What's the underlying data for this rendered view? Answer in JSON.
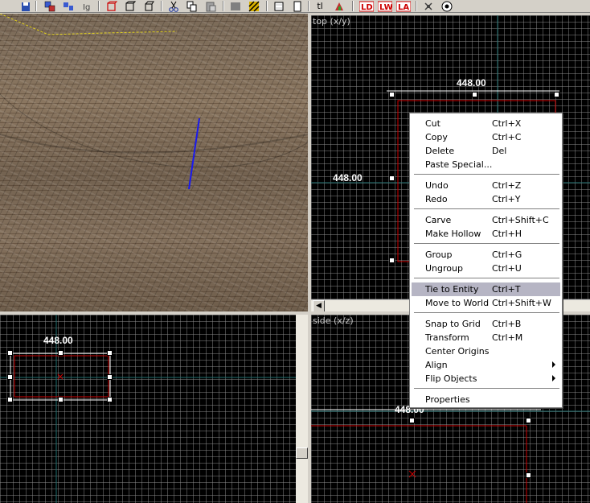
{
  "viewports": {
    "top": {
      "label": "top (x/y)",
      "width_label": "448.00",
      "height_label": "448.00"
    },
    "front": {
      "width_label": "448.00"
    },
    "side": {
      "label": "side (x/z)",
      "width_label": "448.00"
    }
  },
  "toolbar": {
    "icons": [
      "save-icon",
      "group-icon",
      "ungroup-icon",
      "ignore-groups-icon",
      "toggle-face-icon",
      "carve-icon",
      "hollow-icon",
      "cut-icon",
      "copy-icon",
      "paste-icon",
      "texture-lock-icon",
      "hide-items-icon",
      "snap-grid-icon",
      "toggle-grid-icon",
      "tl-icon",
      "entity-icon",
      "load-window-state-icon",
      "save-window-state-icon",
      "load-all-icon",
      "run-map-icon",
      "compile-icon"
    ],
    "tl_text": "tl",
    "colors": {
      "accent_red": "#cc0000",
      "accent_blue": "#0000cc"
    }
  },
  "context_menu": {
    "groups": [
      [
        {
          "label": "Cut",
          "shortcut": "Ctrl+X"
        },
        {
          "label": "Copy",
          "shortcut": "Ctrl+C"
        },
        {
          "label": "Delete",
          "shortcut": "Del"
        },
        {
          "label": "Paste Special...",
          "shortcut": ""
        }
      ],
      [
        {
          "label": "Undo",
          "shortcut": "Ctrl+Z"
        },
        {
          "label": "Redo",
          "shortcut": "Ctrl+Y"
        }
      ],
      [
        {
          "label": "Carve",
          "shortcut": "Ctrl+Shift+C"
        },
        {
          "label": "Make Hollow",
          "shortcut": "Ctrl+H"
        }
      ],
      [
        {
          "label": "Group",
          "shortcut": "Ctrl+G"
        },
        {
          "label": "Ungroup",
          "shortcut": "Ctrl+U"
        }
      ],
      [
        {
          "label": "Tie to Entity",
          "shortcut": "Ctrl+T",
          "highlighted": true
        },
        {
          "label": "Move to World",
          "shortcut": "Ctrl+Shift+W"
        }
      ],
      [
        {
          "label": "Snap to Grid",
          "shortcut": "Ctrl+B"
        },
        {
          "label": "Transform",
          "shortcut": "Ctrl+M"
        },
        {
          "label": "Center Origins",
          "shortcut": ""
        },
        {
          "label": "Align",
          "shortcut": "",
          "submenu": true
        },
        {
          "label": "Flip Objects",
          "shortcut": "",
          "submenu": true
        }
      ],
      [
        {
          "label": "Properties",
          "shortcut": ""
        }
      ]
    ],
    "highlight_color": "#b6b5c4"
  },
  "colors": {
    "selection": "#cc0000",
    "grid_bg": "#000000",
    "grid_line": "#969696",
    "axis_teal": "#1f6f6f",
    "menu_highlight": "#b6b5c4",
    "texture": "#7a6a58"
  }
}
